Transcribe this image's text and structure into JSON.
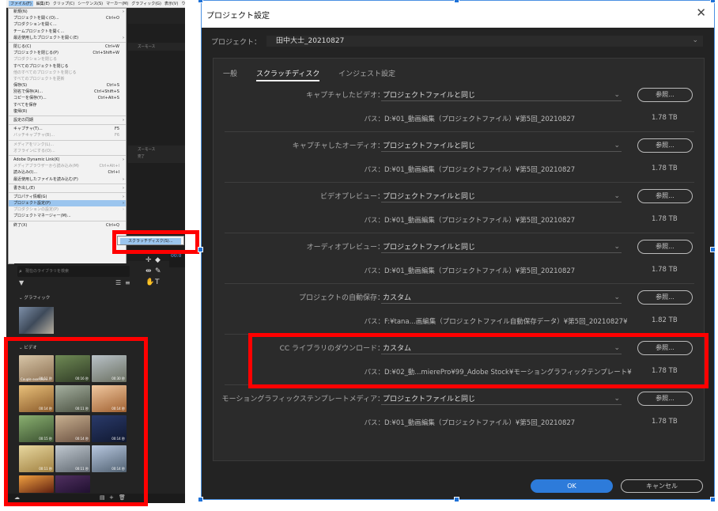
{
  "menubar": [
    "ファイル(F)",
    "編集(E)",
    "クリップ(C)",
    "シーケンス(S)",
    "マーカー(M)",
    "グラフィック(G)",
    "表示(V)",
    "ウィンドウ(W)"
  ],
  "file_menu": [
    {
      "label": "新規(N)",
      "arrow": true
    },
    {
      "label": "プロジェクトを開く(O)...",
      "shortcut": "Ctrl+O"
    },
    {
      "label": "プロダクションを開く..."
    },
    {
      "label": "チームプロジェクトを開く..."
    },
    {
      "label": "最近使用したプロジェクトを開く(E)",
      "arrow": true
    },
    {
      "sep": true
    },
    {
      "label": "閉じる(C)",
      "shortcut": "Ctrl+W"
    },
    {
      "label": "プロジェクトを閉じる(P)",
      "shortcut": "Ctrl+Shift+W"
    },
    {
      "label": "プロダクションを閉じる",
      "disabled": true
    },
    {
      "label": "すべてのプロジェクトを閉じる"
    },
    {
      "label": "他のすべてのプロジェクトを閉じる",
      "disabled": true
    },
    {
      "label": "すべてのプロジェクトを更新",
      "disabled": true
    },
    {
      "label": "保存(S)",
      "shortcut": "Ctrl+S"
    },
    {
      "label": "別名で保存(A)...",
      "shortcut": "Ctrl+Shift+S"
    },
    {
      "label": "コピーを保存(Y)...",
      "shortcut": "Ctrl+Alt+S"
    },
    {
      "label": "すべてを保存"
    },
    {
      "label": "復帰(R)"
    },
    {
      "sep": true
    },
    {
      "label": "設定の同期",
      "arrow": true
    },
    {
      "sep": true
    },
    {
      "label": "キャプチャ(T)...",
      "shortcut": "F5"
    },
    {
      "label": "バッチキャプチャ(B)...",
      "shortcut": "F6",
      "disabled": true
    },
    {
      "sep": true
    },
    {
      "label": "メディアをリンク(L)...",
      "disabled": true
    },
    {
      "label": "オフラインにする(O)...",
      "disabled": true
    },
    {
      "sep": true
    },
    {
      "label": "Adobe Dynamic Link(K)",
      "arrow": true
    },
    {
      "label": "メディアブラウザーから読み込み(M)",
      "shortcut": "Ctrl+Alt+I",
      "disabled": true
    },
    {
      "label": "読み込み(I)...",
      "shortcut": "Ctrl+I"
    },
    {
      "label": "最近使用したファイルを読み込む(F)",
      "arrow": true
    },
    {
      "sep": true
    },
    {
      "label": "書き出し(E)",
      "arrow": true
    },
    {
      "sep": true
    },
    {
      "label": "プロパティ情報(G)",
      "arrow": true
    },
    {
      "label": "プロジェクト設定(P)",
      "arrow": true,
      "highlight": true
    },
    {
      "label": "プロダクションの設定(P)",
      "arrow": true,
      "disabled": true
    },
    {
      "label": "プロジェクトマネージャー(M)..."
    },
    {
      "sep": true
    },
    {
      "label": "終了(X)",
      "shortcut": "Ctrl+Q"
    }
  ],
  "submenu": {
    "label": "スクラッチディスク(S)..."
  },
  "panel_labels": {
    "tab": "履歴作業",
    "band1": "ズーモース",
    "band2": "ズーモース",
    "band2b": "完了",
    "timecode": "00:0"
  },
  "library": {
    "search_placeholder": "現在のライブラリを検索",
    "graphics_label": "グラフィック",
    "video_label": "ビデオ",
    "thumbs": [
      {
        "cap": "Couple exercisin...",
        "dur": "00:11 秒"
      },
      {
        "cap": "",
        "dur": "00:16 秒"
      },
      {
        "cap": "",
        "dur": "00:30 秒"
      },
      {
        "cap": "",
        "dur": "00:14 秒"
      },
      {
        "cap": "",
        "dur": "00:11 秒"
      },
      {
        "cap": "",
        "dur": "00:14 秒"
      },
      {
        "cap": "",
        "dur": "00:15 秒"
      },
      {
        "cap": "",
        "dur": "00:14 秒"
      },
      {
        "cap": "",
        "dur": "00:14 秒"
      },
      {
        "cap": "",
        "dur": "00:11 秒"
      },
      {
        "cap": "",
        "dur": "00:11 秒"
      },
      {
        "cap": "",
        "dur": "00:14 秒"
      },
      {
        "cap": "",
        "dur": ""
      },
      {
        "cap": "",
        "dur": ""
      }
    ]
  },
  "dialog": {
    "title": "プロジェクト設定",
    "project_label": "プロジェクト：",
    "project_value": "田中大士_20210827",
    "tabs": [
      "一般",
      "スクラッチディスク",
      "インジェスト設定"
    ],
    "browse_label": "参照...",
    "path_label": "パス：",
    "rows": [
      {
        "label": "キャプチャしたビデオ：",
        "value": "プロジェクトファイルと同じ",
        "path": "D:¥01_動画編集（プロジェクトファイル）¥第5回_20210827",
        "size": "1.78 TB"
      },
      {
        "label": "キャプチャしたオーディオ：",
        "value": "プロジェクトファイルと同じ",
        "path": "D:¥01_動画編集（プロジェクトファイル）¥第5回_20210827",
        "size": "1.78 TB"
      },
      {
        "label": "ビデオプレビュー：",
        "value": "プロジェクトファイルと同じ",
        "path": "D:¥01_動画編集（プロジェクトファイル）¥第5回_20210827",
        "size": "1.78 TB"
      },
      {
        "label": "オーディオプレビュー：",
        "value": "プロジェクトファイルと同じ",
        "path": "D:¥01_動画編集（プロジェクトファイル）¥第5回_20210827",
        "size": "1.78 TB"
      },
      {
        "label": "プロジェクトの自動保存：",
        "value": "カスタム",
        "path": "F:¥tana...画編集（プロジェクトファイル自動保存データ）¥第5回_20210827¥",
        "size": "1.82 TB"
      },
      {
        "label": "CC ライブラリのダウンロード：",
        "value": "カスタム",
        "path": "D:¥02_動...mierePro¥99_Adobe Stock¥モーショングラフィックテンプレート¥",
        "size": "1.78 TB"
      },
      {
        "label": "モーショングラフィックステンプレートメディア：",
        "value": "プロジェクトファイルと同じ",
        "path": "D:¥01_動画編集（プロジェクトファイル）¥第5回_20210827",
        "size": "1.78 TB"
      }
    ],
    "ok_label": "OK",
    "cancel_label": "キャンセル"
  },
  "colors": {
    "highlight_red": "#ff0000",
    "ok_blue": "#2d7bda",
    "menu_highlight": "#9bc5ee"
  }
}
